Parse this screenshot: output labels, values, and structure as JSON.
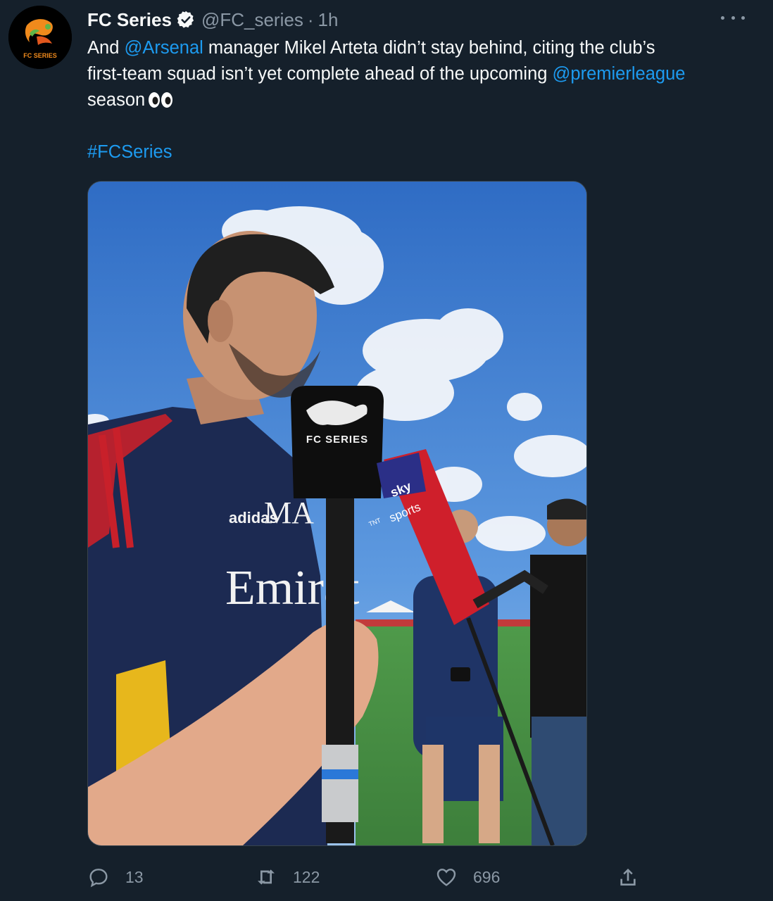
{
  "tweet": {
    "author": {
      "name": "FC Series",
      "handle": "@FC_series",
      "separator": "·",
      "time": "1h",
      "avatar_text": "FC SERIES"
    },
    "text": {
      "line1_a": "And ",
      "mention_arsenal": "@Arsenal",
      "line1_b": " manager Mikel Arteta didn’t stay behind, citing the club’s",
      "line2_a": "first-team squad isn’t yet complete ahead of the upcoming ",
      "mention_pl": "@premierleague",
      "line3": "season",
      "hashtag": "#FCSeries"
    },
    "media": {
      "mic_logo_text": "FC SERIES",
      "sky_text": "sky",
      "sports_text": "sports",
      "tnt_text": "TNT",
      "shirt_initials": "MA",
      "shirt_brand": "adidas",
      "shirt_sponsor": "Emirat"
    },
    "actions": {
      "replies": "13",
      "retweets": "122",
      "likes": "696"
    },
    "icons": {
      "avatar": "fc-series-logo-icon",
      "verified": "verified-badge-icon",
      "more": "more-options-icon",
      "reply": "reply-icon",
      "retweet": "retweet-icon",
      "like": "like-heart-icon",
      "share": "share-icon"
    },
    "colors": {
      "background": "#15202b",
      "link": "#1d9bf0",
      "muted": "#8b98a5",
      "text": "#f7f9f9"
    }
  }
}
